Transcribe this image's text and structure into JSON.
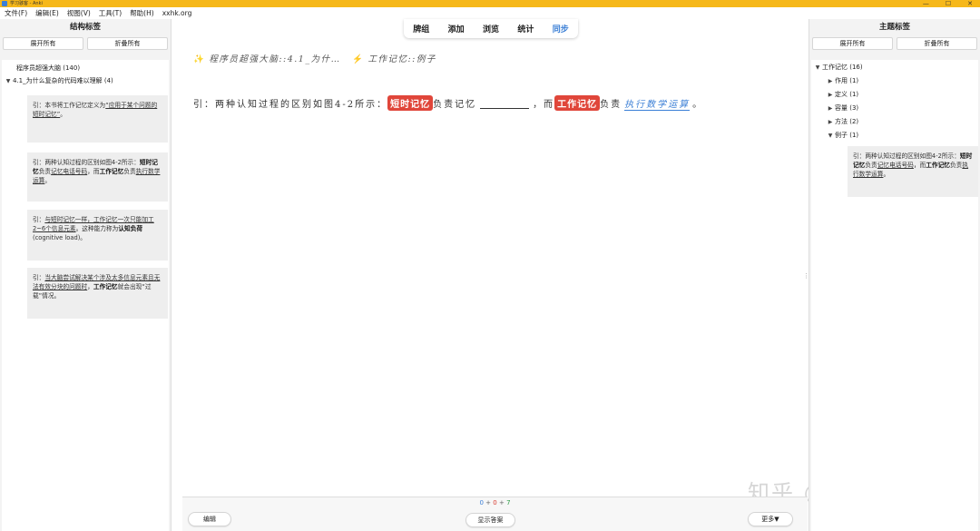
{
  "window": {
    "title": "学习骇客 - Anki",
    "minimize": "—",
    "maximize": "☐",
    "close": "✕"
  },
  "menu": [
    "文件(F)",
    "编辑(E)",
    "视图(V)",
    "工具(T)",
    "帮助(H)",
    "xxhk.org"
  ],
  "left": {
    "title": "结构标签",
    "expand_all": "展开所有",
    "collapse_all": "折叠所有",
    "tree": [
      {
        "label": "程序员超强大脑 (140)"
      },
      {
        "label": "4.1_为什么复杂的代码难以理解 (4)"
      }
    ],
    "notes": [
      {
        "prefix": "引：本书将工作记忆定义为",
        "u": "“应用于某个问题的短时记忆”",
        "suffix": "。"
      },
      {
        "a": "引：两种认知过程的区别如图4-2所示：",
        "b1": "短时记忆",
        "c": "负责",
        "u1": "记忆电话号码",
        "d": "，而",
        "b2": "工作记忆",
        "e": "负责",
        "u2": "执行数学运算",
        "f": "。"
      },
      {
        "a": "引：",
        "u": "与短时记忆一样，工作记忆一次只能加工2~6个信息元素",
        "b": "。这种能力称为",
        "bold": "认知负荷",
        "c": "(cognitive load)。"
      },
      {
        "a": "引：",
        "u": "当大脑尝试解决某个涉及太多信息元素且无法有效分块的问题时",
        "b": "，",
        "bold": "工作记忆",
        "c": "就会出现“过载”情况。"
      }
    ]
  },
  "center": {
    "tabs": [
      "牌组",
      "添加",
      "浏览",
      "统计",
      "同步"
    ],
    "breadcrumb": {
      "deck": "程序员超强大脑::4.1_为什…",
      "tag": "工作记忆::例子"
    },
    "card": {
      "part1": "引：两种认知过程的区别如图4-2所示：",
      "hl1": "短时记忆",
      "part2": "负责记忆",
      "part3": "，而",
      "hl2": "工作记忆",
      "part4": "负责",
      "answer": "执行数学运算",
      "part5": "。"
    },
    "counts": {
      "new": "0",
      "learn": "0",
      "review": "7",
      "plus": "+"
    },
    "edit": "编辑",
    "show_answer": "显示答案",
    "more": "更多▼"
  },
  "right": {
    "title": "主题标签",
    "expand_all": "展开所有",
    "collapse_all": "折叠所有",
    "tree": [
      {
        "label": "工作记忆 (16)"
      },
      {
        "label": "作用 (1)"
      },
      {
        "label": "定义 (1)"
      },
      {
        "label": "容量 (3)"
      },
      {
        "label": "方法 (2)"
      },
      {
        "label": "例子 (1)"
      }
    ],
    "note": {
      "a": "引：两种认知过程的区别如图4-2所示：",
      "b1": "短时记忆",
      "c": "负责",
      "u1": "记忆电话号码",
      "d": "，而",
      "b2": "工作记忆",
      "e": "负责",
      "u2": "执行数学运算",
      "f": "。"
    }
  },
  "watermark": "知乎 @学习骇客",
  "colors": {
    "accent": "#3b7fd6",
    "highlight": "#e0463a",
    "titlebar": "#f6b81a"
  }
}
